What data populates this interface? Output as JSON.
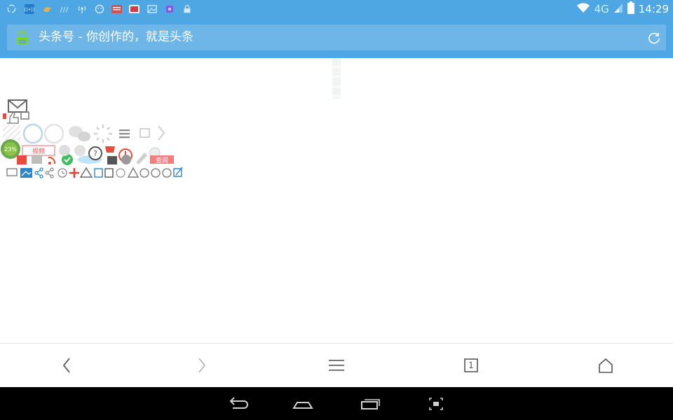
{
  "status_bar": {
    "network": "4G",
    "time": "14:29",
    "notification_icons": [
      "sync-icon",
      "wifi-ap-icon",
      "bird-icon",
      "signal-dim-icon",
      "hotspot-icon",
      "android-icon",
      "news-app-icon",
      "uc-app-icon",
      "image-icon",
      "purple-app-icon",
      "lock-icon"
    ]
  },
  "address_bar": {
    "title": "头条号 - 你创作的，就是头条"
  },
  "content": {
    "broken_sprites": {
      "progress_badge": "23%",
      "tag_label": "视频",
      "report_label": "查阅"
    }
  },
  "toolbar": {
    "tab_count": "1"
  },
  "colors": {
    "accent": "#4ea7e2",
    "lock_green": "#7ed321",
    "navbar": "#000000"
  }
}
